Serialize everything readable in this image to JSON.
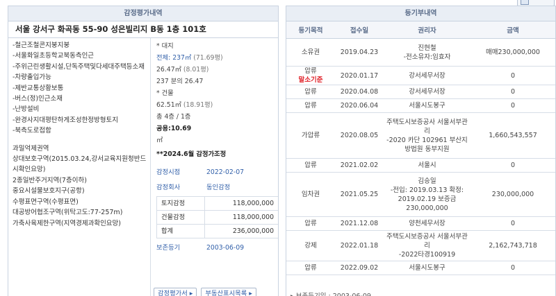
{
  "left": {
    "header": "감정평가내역",
    "address": "서울 강서구 화곡동 55-90 성은빌리지 B동 1층 101호",
    "features": [
      "-철근조철콘지붕지붕",
      "-서울화일초등학교북동측인근",
      "-주위근린생활시설,단독주택및다세대주택등소재",
      "-차량출입가능",
      "-제반교통상황보통",
      "-버스(정)인근소재",
      "-난방설비",
      "-완경사지대평탄하게조성한정방형토지",
      "-북측도로접함"
    ],
    "zoning": [
      "과밀억제권역",
      "상대보호구역(2015.03.24,강서교육지원청반드시확인요망)",
      "2종일반주거지역(7층이하)",
      "중요시설물보호지구(공항)",
      "수평표면구역(수평표면)",
      "대공방어협조구역(위탁고도:77-257m)",
      "가축사육제한구역(지역경제과확인요망)"
    ],
    "info": {
      "land": "* 대지",
      "land_area": "전체: 237㎡",
      "land_area_py": "(71.69평)",
      "share_area": "26.47㎡",
      "share_area_py": "(8.01평)",
      "share_ratio": "237 분의 26.47",
      "building": "* 건물",
      "bldg_area": "62.51㎡",
      "bldg_area_py": "(18.91평)",
      "floors": "총 4층 / 1층",
      "usage": "공용:10.69",
      "unit": "㎡",
      "adjust": "**2024.6월 감정가조정",
      "appraisal_date_label": "감정시점",
      "appraisal_date": "2022-02-07",
      "company_label": "감정회사",
      "company": "동인감정",
      "table": [
        [
          "토지감정",
          "118,000,000"
        ],
        [
          "건물감정",
          "118,000,000"
        ],
        [
          "합계",
          "236,000,000"
        ]
      ],
      "reg_label": "보존등기",
      "reg_date": "2003-06-09"
    },
    "buttons": [
      "감정평가서 ▸",
      "부동산표시목록 ▸"
    ]
  },
  "right": {
    "header": "등기부내역",
    "columns": [
      "등기목적",
      "접수일",
      "권리자",
      "금액"
    ],
    "rows": [
      {
        "purpose": "소유권",
        "date": "2019.04.23",
        "holder": "진현철\n-전소유자:임효자",
        "amount": "매매230,000,000"
      },
      {
        "purpose": "압류",
        "purpose2": "말소기준",
        "date": "2020.01.17",
        "holder": "강서세무서장",
        "amount": "0"
      },
      {
        "purpose": "압류",
        "date": "2020.04.08",
        "holder": "강서세무서장",
        "amount": "0"
      },
      {
        "purpose": "압류",
        "date": "2020.06.04",
        "holder": "서울시도봉구",
        "amount": "0"
      },
      {
        "purpose": "가압류",
        "date": "2020.08.05",
        "holder": "주택도시보증공사 서울서부관리\n-2020 카단 102961 부산지방법원 동부지원",
        "amount": "1,660,543,557"
      },
      {
        "purpose": "압류",
        "date": "2021.02.02",
        "holder": "서울시",
        "amount": "0"
      },
      {
        "purpose": "임차권",
        "date": "2021.05.25",
        "holder": "김승일\n-전입: 2019.03.13 확정: 2019.02.19 보증금 230,000,000",
        "amount": "230,000,000"
      },
      {
        "purpose": "압류",
        "date": "2021.12.08",
        "holder": "양천세무서장",
        "amount": "0"
      },
      {
        "purpose": "강제",
        "date": "2022.01.18",
        "holder": "주택도시보증공사 서울서부관리\n-2022타경100919",
        "amount": "2,162,743,718",
        "highlight": true
      },
      {
        "purpose": "압류",
        "date": "2022.09.02",
        "holder": "서울시도봉구",
        "amount": "0"
      }
    ],
    "footer": "▸ 보존등기일 : 2003-06-09"
  }
}
